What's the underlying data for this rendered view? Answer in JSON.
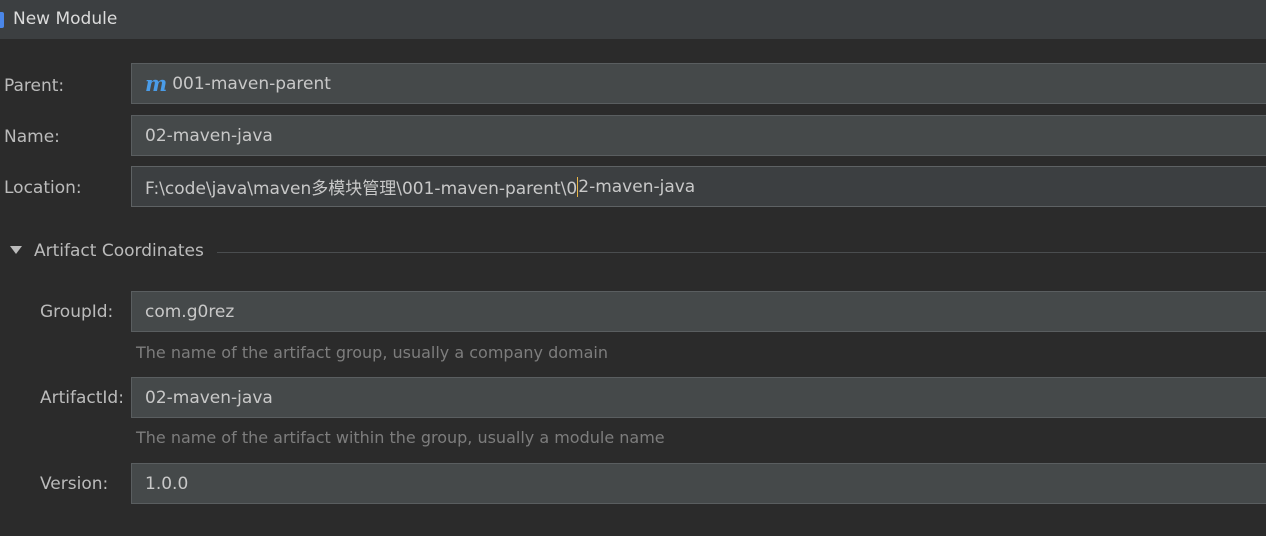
{
  "window": {
    "title": "New Module"
  },
  "form": {
    "parent": {
      "label": "Parent:",
      "value": "001-maven-parent",
      "icon": "m-icon",
      "icon_glyph": "m"
    },
    "name": {
      "label": "Name:",
      "value": "02-maven-java"
    },
    "location": {
      "label": "Location:",
      "value_before_caret": "F:\\code\\java\\maven多模块管理\\001-maven-parent\\0",
      "value_after_caret": "2-maven-java"
    }
  },
  "artifact_coordinates": {
    "title": "Artifact Coordinates",
    "expanded": true,
    "group_id": {
      "label": "GroupId:",
      "value": "com.g0rez",
      "hint": "The name of the artifact group, usually a company domain"
    },
    "artifact_id": {
      "label": "ArtifactId:",
      "value": "02-maven-java",
      "hint": "The name of the artifact within the group, usually a module name"
    },
    "version": {
      "label": "Version:",
      "value": "1.0.0"
    }
  },
  "colors": {
    "background": "#2b2b2b",
    "field": "#45494a",
    "accent": "#4a86e8",
    "maven_icon": "#4a9ce8",
    "caret": "#e8b64a"
  }
}
